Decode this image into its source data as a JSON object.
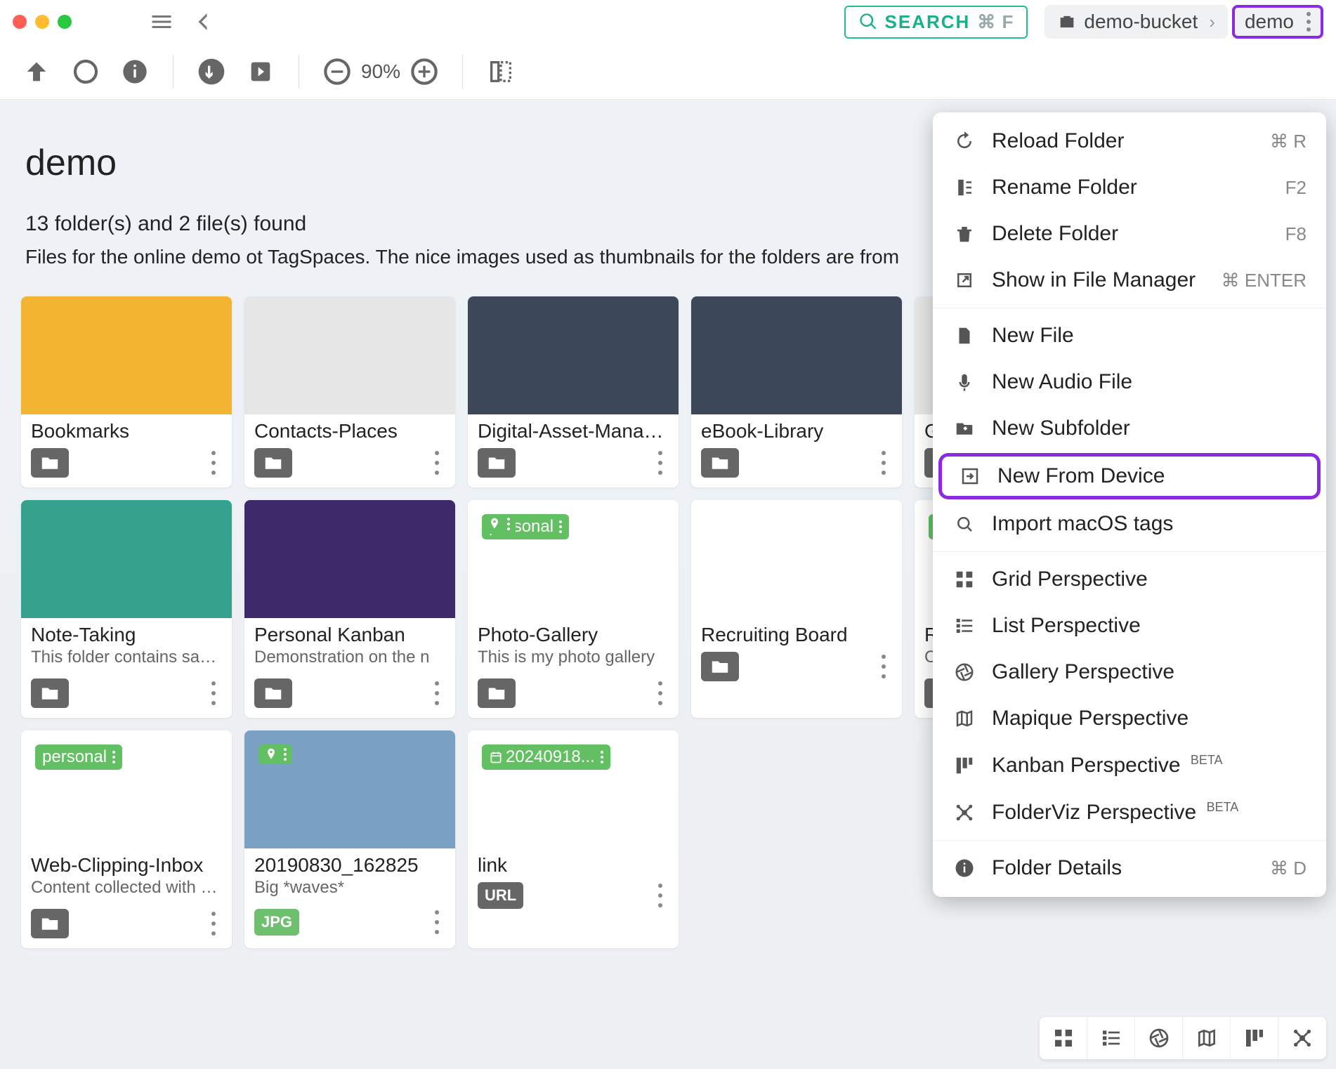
{
  "titlebar": {
    "search_label": "SEARCH",
    "search_shortcut": "⌘ F",
    "breadcrumb": [
      {
        "icon": "briefcase",
        "label": "demo-bucket"
      },
      {
        "icon": "",
        "label": "demo",
        "highlighted": true
      }
    ]
  },
  "subbar": {
    "zoom_percent": "90%"
  },
  "header": {
    "title": "demo",
    "summary": "13 folder(s) and 2 file(s) found",
    "description": "Files for the online demo ot TagSpaces. The nice images used as thumbnails for the folders are from"
  },
  "cards": [
    {
      "title": "Bookmarks",
      "desc": "",
      "type": "folder",
      "thumb": "yellow"
    },
    {
      "title": "Contacts-Places",
      "desc": "",
      "type": "folder",
      "thumb": "grey"
    },
    {
      "title": "Digital-Asset-Management",
      "desc": "",
      "type": "folder",
      "thumb": "dark"
    },
    {
      "title": "eBook-Library",
      "desc": "",
      "type": "folder",
      "thumb": "dark"
    },
    {
      "title": "Getting-Started",
      "desc": "",
      "type": "folder",
      "thumb": "grey"
    },
    {
      "title": "",
      "desc": "",
      "type": "folder",
      "thumb": "grey",
      "hidden": true
    },
    {
      "title": "Note-Taking",
      "desc": "This folder contains sample notes",
      "type": "folder",
      "thumb": "teal"
    },
    {
      "title": "Personal Kanban",
      "desc": "Demonstration on the n",
      "type": "folder",
      "thumb": "purple"
    },
    {
      "title": "Photo-Gallery",
      "desc": "This is my photo gallery",
      "type": "folder",
      "thumb": "white",
      "tags": [
        "personal",
        "geo"
      ]
    },
    {
      "title": "Recruiting Board",
      "desc": "",
      "type": "folder",
      "thumb": "white"
    },
    {
      "title": "Research",
      "desc": "Cr",
      "type": "folder",
      "thumb": "white",
      "tags": [
        "w"
      ]
    },
    {
      "title": "",
      "desc": "",
      "type": "folder",
      "thumb": "grey",
      "hidden": true
    },
    {
      "title": "Web-Clipping-Inbox",
      "desc": "Content collected with the web clipper",
      "type": "folder",
      "thumb": "white",
      "tags": [
        "personal"
      ]
    },
    {
      "title": "20190830_162825",
      "desc": "Big *waves*",
      "type": "file",
      "ext": "JPG",
      "thumb": "photo",
      "tags": [
        "geo"
      ]
    },
    {
      "title": "link",
      "desc": "",
      "type": "file",
      "ext": "URL",
      "thumb": "white",
      "tags": [
        "date"
      ],
      "tag_label": "20240918..."
    }
  ],
  "menu": {
    "items": [
      {
        "icon": "reload",
        "label": "Reload Folder",
        "shortcut": "⌘ R"
      },
      {
        "icon": "rename",
        "label": "Rename Folder",
        "shortcut": "F2"
      },
      {
        "icon": "trash",
        "label": "Delete Folder",
        "shortcut": "F8"
      },
      {
        "icon": "open-ext",
        "label": "Show in File Manager",
        "shortcut": "⌘ ENTER"
      },
      {
        "sep": true
      },
      {
        "icon": "file",
        "label": "New File"
      },
      {
        "icon": "mic",
        "label": "New Audio File"
      },
      {
        "icon": "folder-plus",
        "label": "New Subfolder"
      },
      {
        "icon": "import",
        "label": "New From Device",
        "highlight": true
      },
      {
        "icon": "search-doc",
        "label": "Import macOS tags"
      },
      {
        "sep": true
      },
      {
        "icon": "grid",
        "label": "Grid Perspective"
      },
      {
        "icon": "list",
        "label": "List Perspective"
      },
      {
        "icon": "aperture",
        "label": "Gallery Perspective"
      },
      {
        "icon": "map",
        "label": "Mapique Perspective"
      },
      {
        "icon": "kanban",
        "label": "Kanban Perspective",
        "beta": true
      },
      {
        "icon": "graph",
        "label": "FolderViz Perspective",
        "beta": true
      },
      {
        "sep": true
      },
      {
        "icon": "info",
        "label": "Folder Details",
        "shortcut": "⌘ D"
      }
    ]
  },
  "perspective_icons": [
    "grid",
    "list",
    "aperture",
    "map",
    "kanban",
    "graph"
  ],
  "beta_label": "BETA"
}
